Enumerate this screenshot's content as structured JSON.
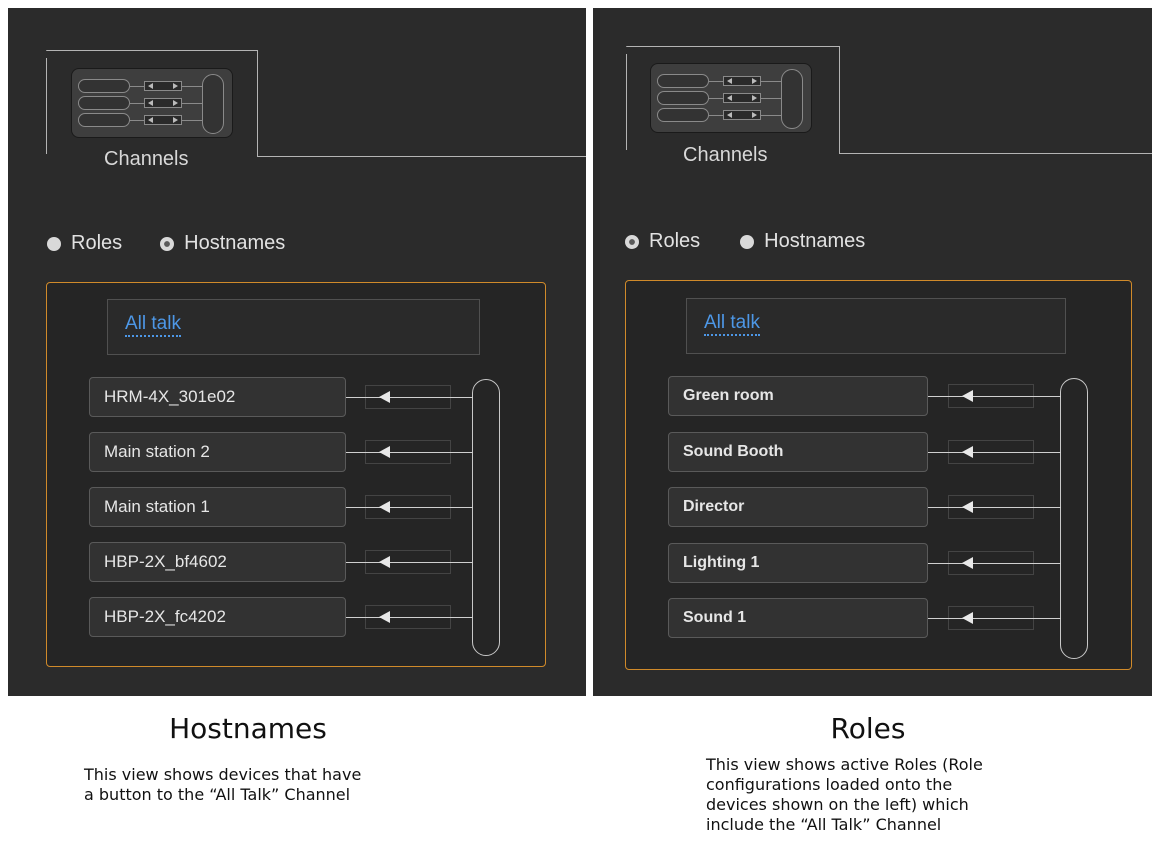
{
  "left": {
    "tab_label": "Channels",
    "radios": [
      {
        "label": "Roles",
        "checked": false
      },
      {
        "label": "Hostnames",
        "checked": true
      }
    ],
    "channel_name": "All talk",
    "devices": [
      "HRM-4X_301e02",
      "Main station 2",
      "Main station 1",
      "HBP-2X_bf4602",
      "HBP-2X_fc4202"
    ]
  },
  "right": {
    "tab_label": "Channels",
    "radios": [
      {
        "label": "Roles",
        "checked": true
      },
      {
        "label": "Hostnames",
        "checked": false
      }
    ],
    "channel_name": "All talk",
    "devices": [
      "Green room",
      "Sound Booth",
      "Director",
      "Lighting 1",
      "Sound 1"
    ]
  },
  "captions": {
    "left_title": "Hostnames",
    "left_text_1": "This view shows devices that have",
    "left_text_2": "a button to the  “All Talk” Channel",
    "right_title": "Roles",
    "right_text_1": "This view shows active Roles (Role",
    "right_text_2": "configurations loaded onto the",
    "right_text_3": "devices shown on the left) which",
    "right_text_4": "include the “All Talk” Channel"
  },
  "colors": {
    "panel_bg": "#2b2b2b",
    "channel_border": "#d08a2a",
    "link": "#4d97e6"
  }
}
